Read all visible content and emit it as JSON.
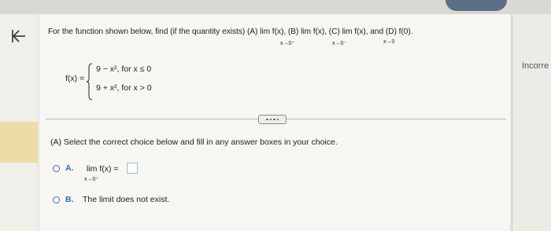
{
  "question": {
    "prompt": "For the function shown below, find (if the quantity exists) (A) lim  f(x), (B) lim  f(x), (C) lim  f(x), and (D) f(0).",
    "limits": [
      "x→0⁺",
      "x→0⁻",
      "x→0"
    ]
  },
  "function": {
    "label": "f(x) =",
    "cases": [
      {
        "expr": "9 − x², ",
        "cond": "for x ≤ 0"
      },
      {
        "expr": "9 + x², ",
        "cond": "for x > 0"
      }
    ]
  },
  "part_a": {
    "instruction": "(A) Select the correct choice below and fill in any answer boxes in your choice.",
    "options": [
      {
        "letter": "A.",
        "text": "lim  f(x) =",
        "sub": "x→0⁺"
      },
      {
        "letter": "B.",
        "text": "The limit does not exist."
      }
    ]
  },
  "side": {
    "incorrect_label": "Incorre"
  },
  "colors": {
    "accent": "#2e6bb8",
    "highlight": "#ecdca8"
  }
}
